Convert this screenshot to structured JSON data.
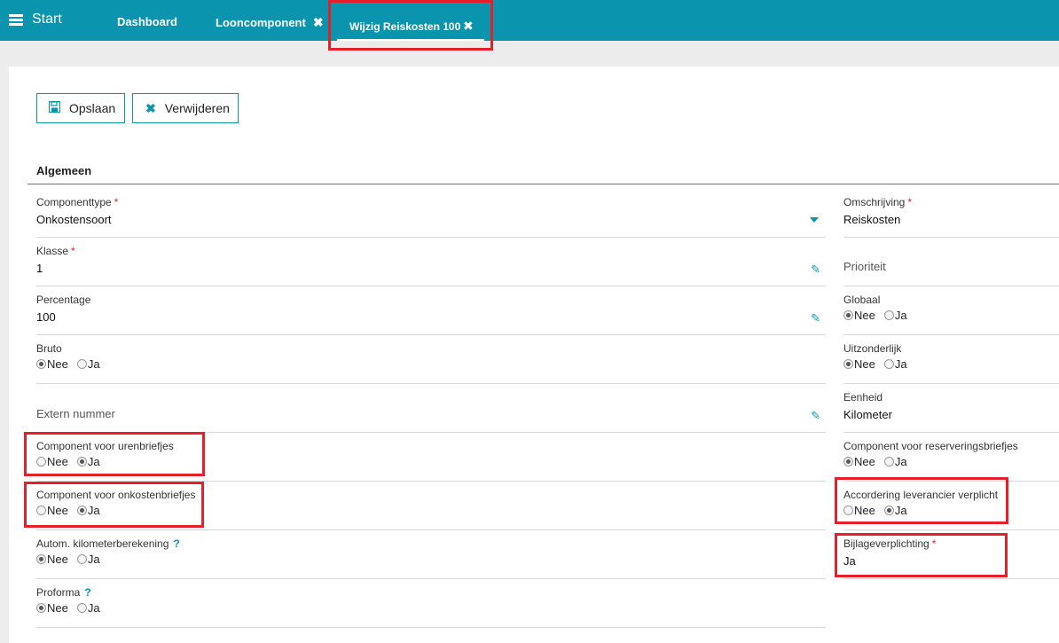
{
  "topbar": {
    "start_label": "Start",
    "tabs": [
      {
        "label": "Dashboard",
        "closable": false
      },
      {
        "label": "Looncomponent",
        "closable": true
      },
      {
        "label": "Wijzig Reiskosten 100",
        "closable": true,
        "active": true
      }
    ],
    "close_glyph": "✖"
  },
  "toolbar": {
    "save_label": "Opslaan",
    "delete_label": "Verwijderen"
  },
  "section": {
    "title": "Algemeen"
  },
  "radio_labels": {
    "no": "Nee",
    "yes": "Ja"
  },
  "required_mark": "*",
  "help_mark": "?",
  "left_fields": {
    "componenttype": {
      "label": "Componenttype",
      "value": "Onkostensoort"
    },
    "klasse": {
      "label": "Klasse",
      "value": "1"
    },
    "percentage": {
      "label": "Percentage",
      "value": "100"
    },
    "bruto": {
      "label": "Bruto",
      "selected": "Nee"
    },
    "extern_nummer": {
      "label": "Extern nummer",
      "value": ""
    },
    "urenbriefjes": {
      "label": "Component voor urenbriefjes",
      "selected": "Ja"
    },
    "onkostenbriefjes": {
      "label": "Component voor onkostenbriefjes",
      "selected": "Ja"
    },
    "kilometerberekening": {
      "label": "Autom. kilometerberekening",
      "selected": "Nee"
    },
    "proforma": {
      "label": "Proforma",
      "selected": "Nee"
    }
  },
  "right_fields": {
    "omschrijving": {
      "label": "Omschrijving",
      "value": "Reiskosten"
    },
    "prioriteit": {
      "label": "Prioriteit",
      "value": ""
    },
    "globaal": {
      "label": "Globaal",
      "selected": "Nee"
    },
    "uitzonderlijk": {
      "label": "Uitzonderlijk",
      "selected": "Nee"
    },
    "eenheid": {
      "label": "Eenheid",
      "value": "Kilometer"
    },
    "reserveringsbriefjes": {
      "label": "Component voor reserveringsbriefjes",
      "selected": "Nee"
    },
    "accordering": {
      "label": "Accordering leverancier verplicht",
      "selected": "Ja"
    },
    "bijlageverplichting": {
      "label": "Bijlageverplichting",
      "value": "Ja"
    }
  },
  "colors": {
    "accent": "#0a94ad",
    "highlight": "#e5202a",
    "required": "#e5202a"
  }
}
